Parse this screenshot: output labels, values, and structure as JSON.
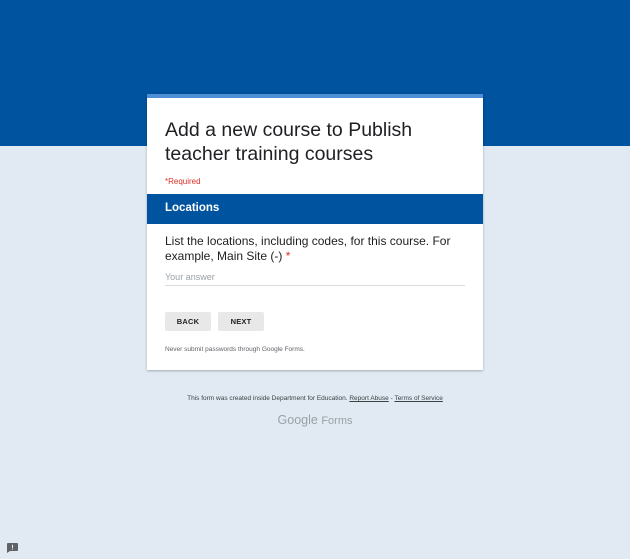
{
  "form": {
    "title": "Add a new course to Publish teacher training courses",
    "required_note": "*Required",
    "section_title": "Locations",
    "question": "List the locations, including codes, for this course. For example, Main Site (-)",
    "question_required_marker": "*",
    "answer_placeholder": "Your answer",
    "answer_value": "",
    "back_label": "BACK",
    "next_label": "NEXT",
    "password_note": "Never submit passwords through Google Forms."
  },
  "footer": {
    "created_text": "This form was created inside Department for Education.",
    "report_abuse": "Report Abuse",
    "separator": "-",
    "terms": "Terms of Service",
    "brand_google": "Google",
    "brand_forms": "Forms"
  },
  "colors": {
    "header_blue": "#00539f",
    "background": "#e1eaf3",
    "card_accent": "#4f8fd6",
    "required_red": "#d93025"
  },
  "icons": {
    "feedback": "feedback-icon"
  }
}
